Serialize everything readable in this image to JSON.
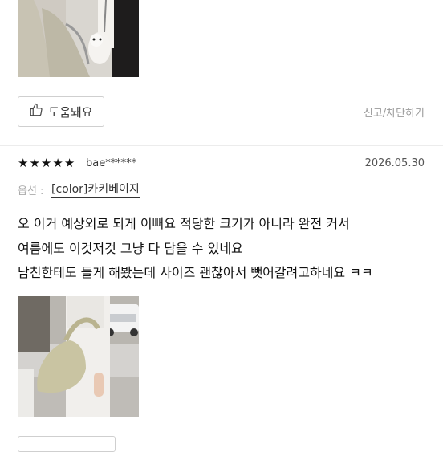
{
  "top_review": {
    "helpful_label": "도움돼요",
    "report_label": "신고/차단하기"
  },
  "review": {
    "stars": [
      "★",
      "★",
      "★",
      "★",
      "★"
    ],
    "user": "bae******",
    "date": "2026.05.30",
    "option_label": "옵션 :",
    "option_value": "[color]카키베이지",
    "lines": [
      "오 이거 예상외로 되게 이뻐요 적당한 크기가 아니라 완전 커서",
      "여름에도 이것저것 그냥 다 담을 수 있네요",
      "남친한테도 들게 해봤는데 사이즈 괜찮아서 뺏어갈려고하네요 ㅋㅋ"
    ]
  },
  "icons": {
    "thumbs_up": "thumbs-up-icon"
  }
}
